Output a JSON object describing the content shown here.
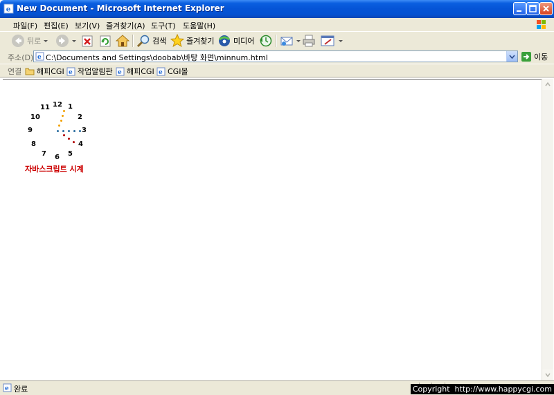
{
  "window": {
    "title": "New Document - Microsoft Internet Explorer"
  },
  "menu": [
    "파일(F)",
    "편집(E)",
    "보기(V)",
    "즐겨찾기(A)",
    "도구(T)",
    "도움말(H)"
  ],
  "toolbar": {
    "back": "뒤로",
    "search": "검색",
    "favorites": "즐겨찾기",
    "media": "미디어"
  },
  "address": {
    "label": "주소(D)",
    "value": "C:\\Documents and Settings\\doobab\\바탕 화면\\minnum.html",
    "go": "이동"
  },
  "links": {
    "label": "연결",
    "items": [
      "해피CGI",
      "작업알림판",
      "해피CGI",
      "CGI몰"
    ]
  },
  "clock": {
    "numbers": [
      "12",
      "1",
      "2",
      "3",
      "4",
      "5",
      "6",
      "7",
      "8",
      "9",
      "10",
      "11"
    ],
    "caption": "자바스크립트 시계",
    "colors": {
      "hour": "#b00000",
      "minute": "#2a6ea0",
      "second": "#f2a000"
    }
  },
  "status": {
    "text": "완료"
  },
  "caption": "Copyright  http://www.happycgi.com"
}
